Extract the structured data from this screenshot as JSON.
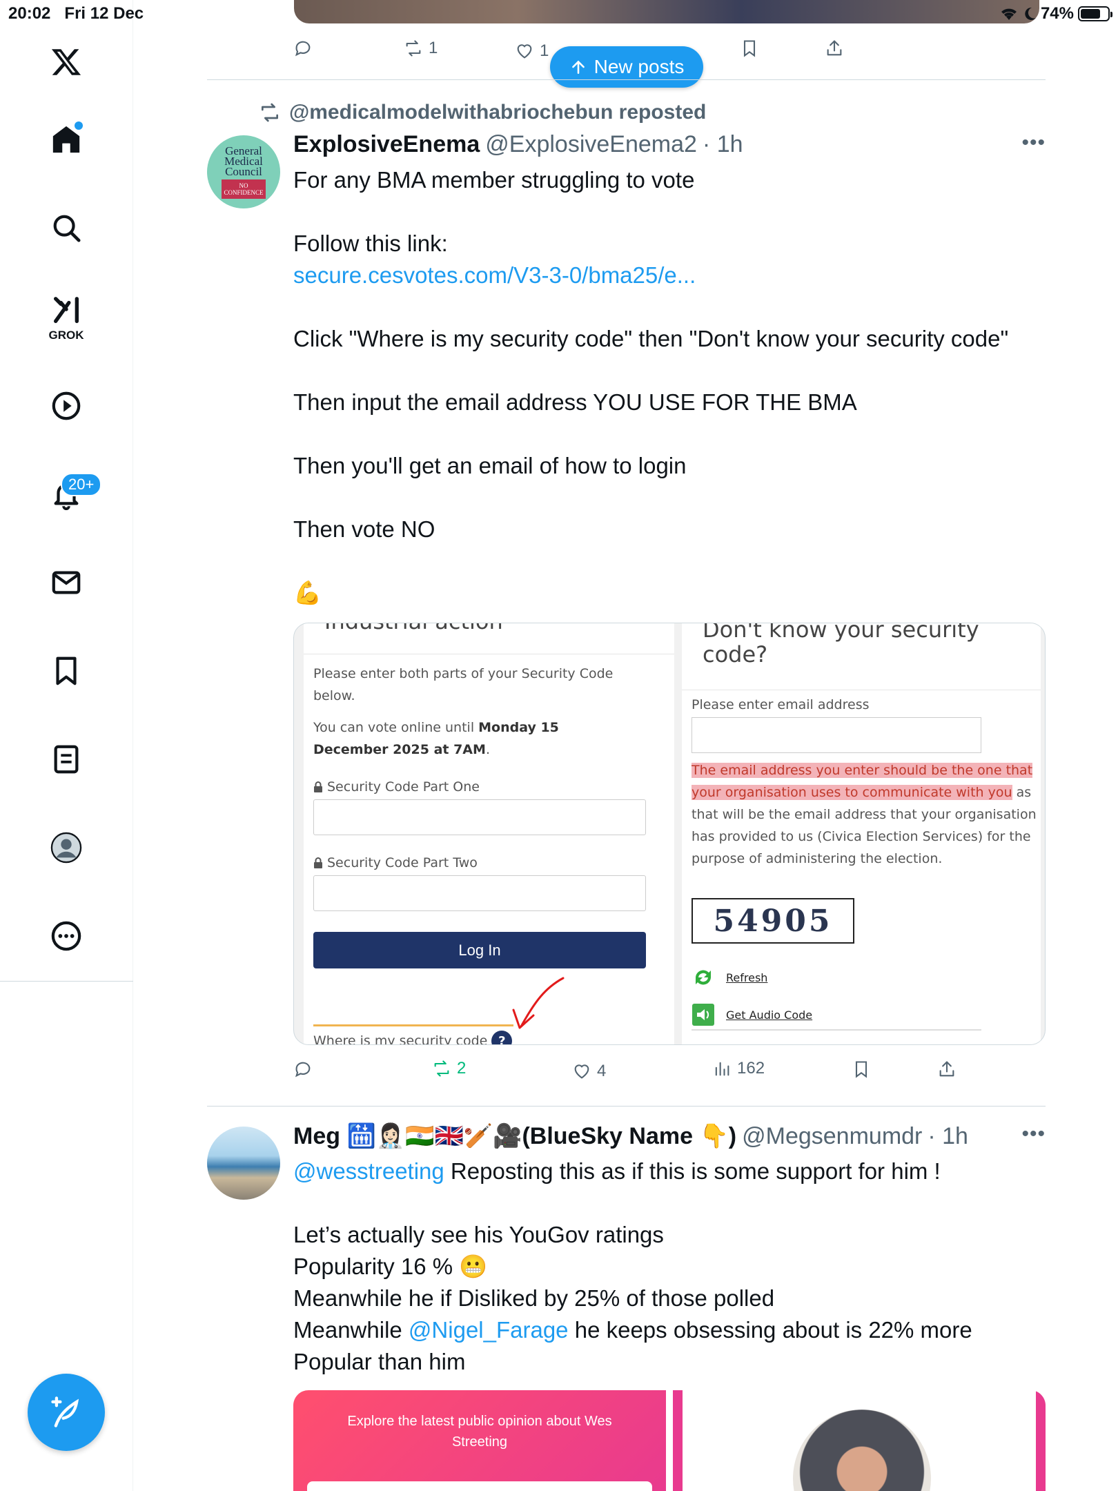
{
  "status_bar": {
    "time": "20:02",
    "date": "Fri 12 Dec",
    "battery": "74%",
    "battery_level": 0.74
  },
  "sidebar": {
    "items": [
      {
        "icon": "x-logo-icon"
      },
      {
        "icon": "home-icon",
        "has_dot": true
      },
      {
        "icon": "search-icon"
      },
      {
        "icon": "grok-icon",
        "label": "GROK"
      },
      {
        "icon": "video-play-icon"
      },
      {
        "icon": "bell-icon",
        "badge": "20+"
      },
      {
        "icon": "mail-icon"
      },
      {
        "icon": "bookmark-icon"
      },
      {
        "icon": "lists-icon"
      },
      {
        "icon": "profile-icon"
      },
      {
        "icon": "more-icon"
      }
    ],
    "compose_icon": "compose-feather-icon"
  },
  "new_posts": {
    "label": "New posts"
  },
  "prev_tweet_actions": {
    "reposts": "1",
    "likes": "1"
  },
  "tweet1": {
    "repost_by": "@medicalmodelwithabriochebun reposted",
    "name": "ExplosiveEnema",
    "handle": "@ExplosiveEnema2",
    "time": "· 1h",
    "avatar_text": {
      "l1": "General",
      "l2": "Medical",
      "l3": "Council",
      "sub": "NO CONFIDENCE"
    },
    "lines": [
      "For any BMA member struggling to vote",
      "",
      "Follow this link:",
      "secure.cesvotes.com/V3-3-0/bma25/e...",
      "",
      "Click \"Where is my security code\" then \"Don't know your security code\"",
      "",
      "Then input the email address YOU USE FOR THE BMA",
      "",
      "Then you'll get an email of how to login",
      "",
      "Then vote NO",
      "",
      "💪"
    ],
    "media": {
      "left": {
        "cut_heading": "Industrial action",
        "intro": "Please enter both parts of your Security Code below.",
        "vote_until_prefix": "You can vote online until ",
        "vote_until_bold": "Monday 15 December 2025 at 7AM",
        "vote_until_suffix": ".",
        "part_one": "Security Code Part One",
        "part_two": "Security Code Part Two",
        "login": "Log In",
        "where_link": "Where is my security code"
      },
      "right": {
        "heading_l1": "Don't know your security",
        "heading_l2": "code?",
        "email_label": "Please enter email address",
        "note_hl": "The email address you enter should be the one that your organisation uses to communicate with you",
        "note_rest": " as that will be the email address that your organisation has provided to us (Civica Election Services) for the purpose of administering the election.",
        "captcha": "54905",
        "refresh": "Refresh",
        "audio": "Get Audio Code"
      }
    },
    "actions": {
      "reposts": "2",
      "likes": "4",
      "views": "162"
    }
  },
  "tweet2": {
    "name": "Meg 🛗👩🏻‍⚕️🇮🇳🇬🇧🏏🎥(BlueSky Name 👇)",
    "handle": "@Megsenmumdr",
    "time": "· 1h",
    "mention": "@wesstreeting",
    "line1_rest": " Reposting this as if this is some support for him !",
    "line2": "Let’s actually see his YouGov ratings",
    "line3": "Popularity 16 % 😬",
    "line4": "Meanwhile he if Disliked by 25% of those polled",
    "line5_prefix": "Meanwhile ",
    "line5_mention": "@Nigel_Farage",
    "line5_rest": " he keeps obsessing about is 22% more",
    "line6": "Popular than him",
    "media_left_text": "Explore the latest public opinion about Wes Streeting"
  },
  "colors": {
    "accent": "#1d9bf0",
    "repost_green": "#00ba7c",
    "text": "#0f1419",
    "muted": "#536471"
  }
}
